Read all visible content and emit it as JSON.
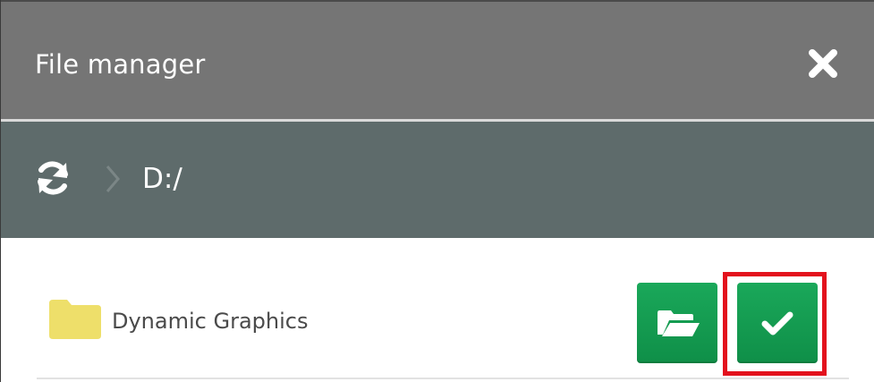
{
  "dialog": {
    "title": "File manager",
    "close_icon": "close-icon"
  },
  "pathbar": {
    "refresh_icon": "refresh-icon",
    "separator_icon": "chevron-right-icon",
    "path": "D:/"
  },
  "items": [
    {
      "icon": "folder-icon",
      "name": "Dynamic Graphics",
      "actions": [
        {
          "icon": "folder-open-icon"
        },
        {
          "icon": "checkmark-icon"
        }
      ]
    }
  ],
  "colors": {
    "titlebar": "#757575",
    "pathbar": "#5e6b6b",
    "button": "#119b4e",
    "folder": "#eedf6a",
    "highlight": "#e3121d"
  }
}
